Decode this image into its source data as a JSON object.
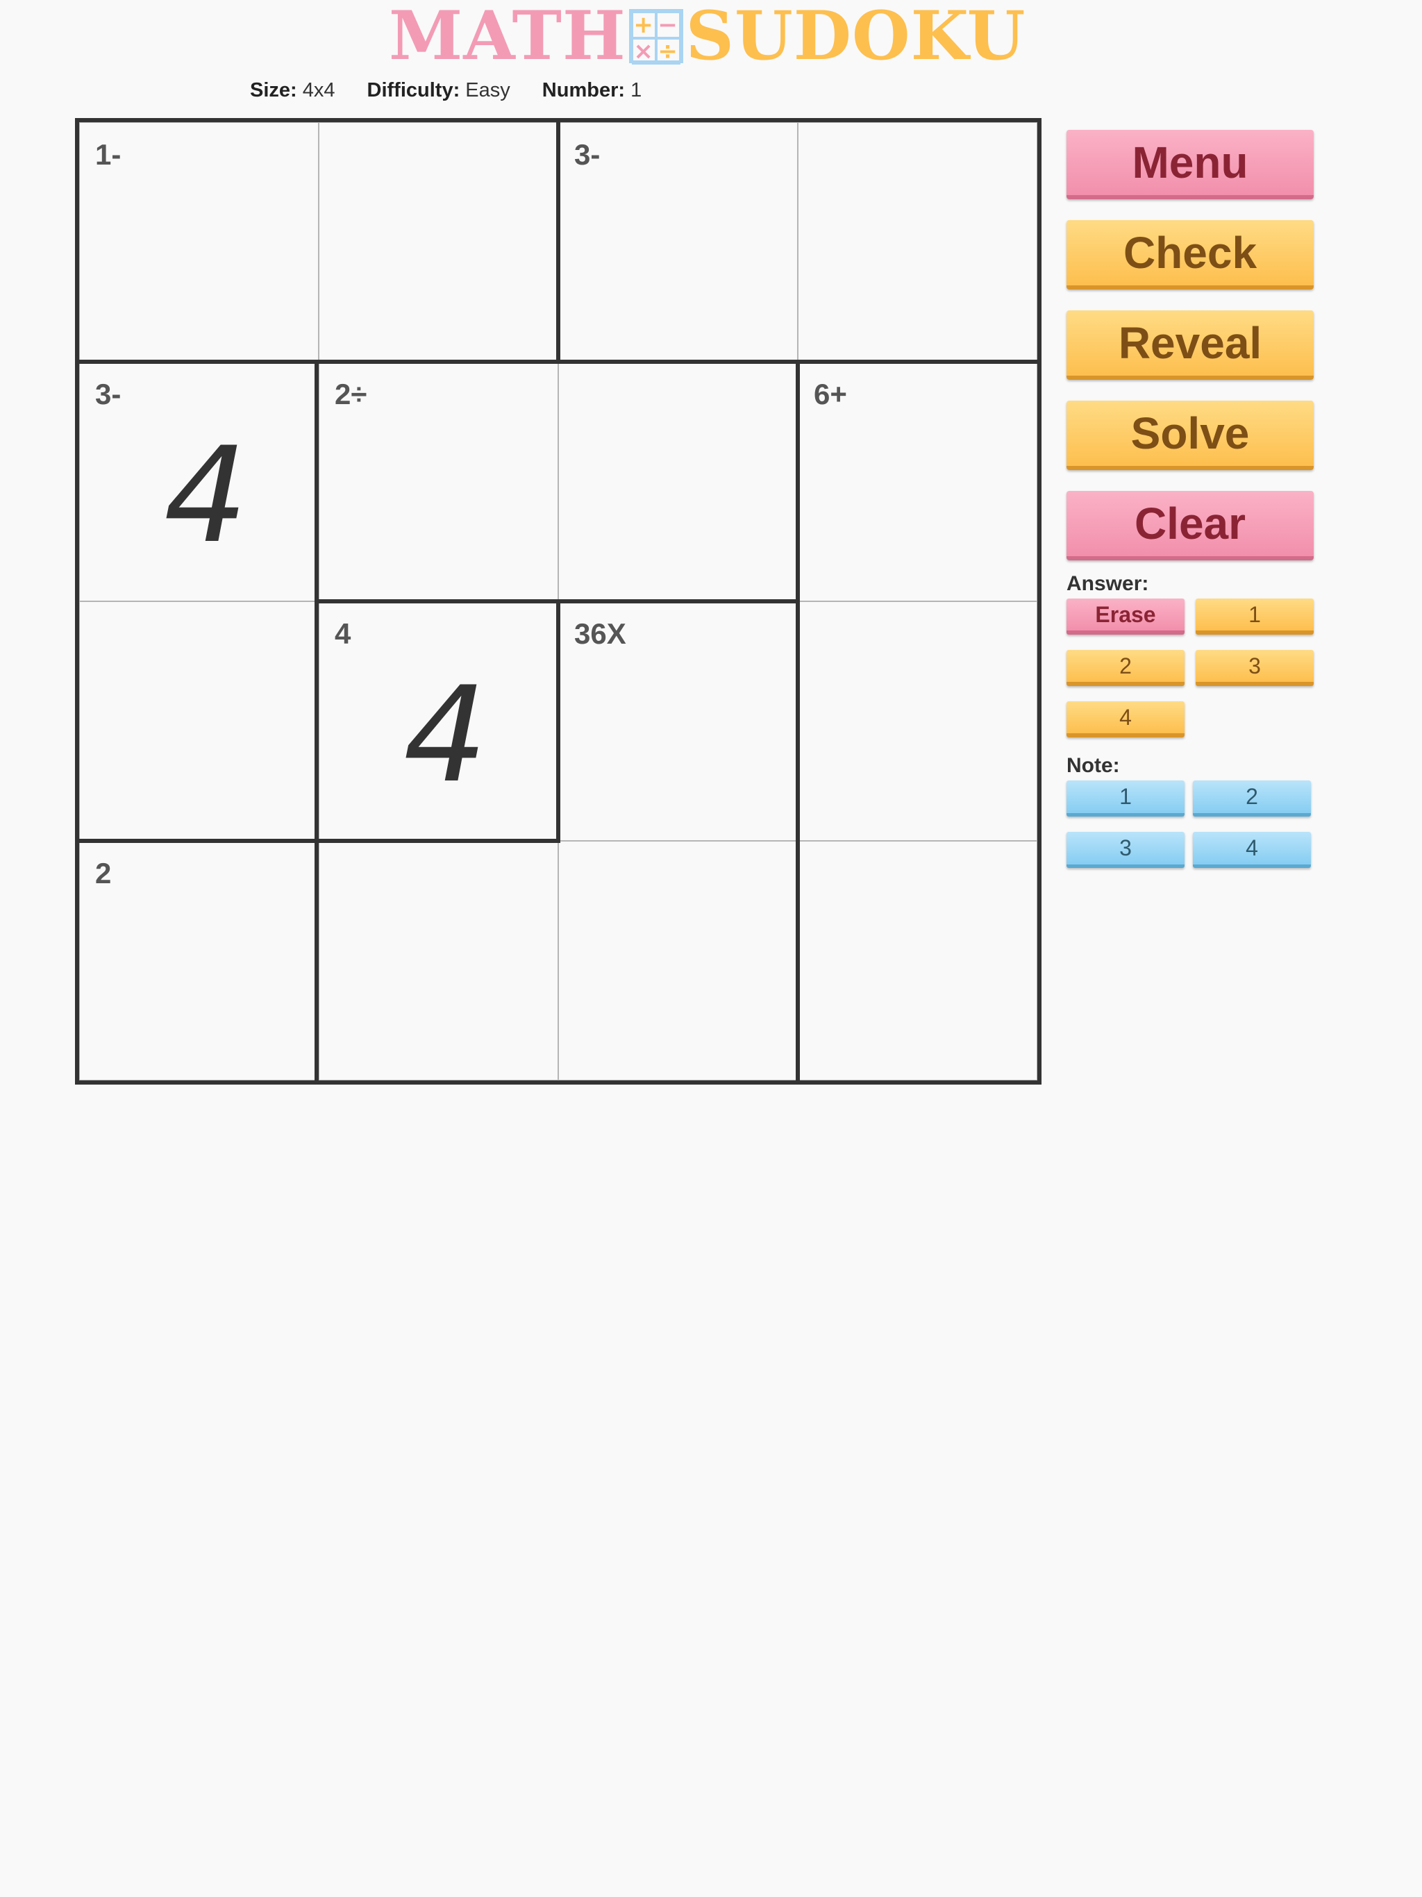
{
  "logo": {
    "left_text": "MATH",
    "right_text": "SUDOKU",
    "mark_symbols": [
      "+",
      "−",
      "×",
      "÷"
    ]
  },
  "info": {
    "size_label": "Size:",
    "size_value": "4x4",
    "difficulty_label": "Difficulty:",
    "difficulty_value": "Easy",
    "number_label": "Number:",
    "number_value": "1"
  },
  "board": {
    "size": 4,
    "clues": [
      [
        "1-",
        "",
        "3-",
        ""
      ],
      [
        "3-",
        "2÷",
        "",
        "6+"
      ],
      [
        "",
        "4",
        "36X",
        ""
      ],
      [
        "2",
        "",
        "",
        ""
      ]
    ],
    "values": [
      [
        "",
        "",
        "",
        ""
      ],
      [
        "4",
        "",
        "",
        ""
      ],
      [
        "",
        "4",
        "",
        ""
      ],
      [
        "",
        "",
        "",
        ""
      ]
    ]
  },
  "controls": {
    "menu": "Menu",
    "check": "Check",
    "reveal": "Reveal",
    "solve": "Solve",
    "clear": "Clear"
  },
  "answer": {
    "label": "Answer:",
    "erase": "Erase",
    "numbers": [
      "1",
      "2",
      "3",
      "4"
    ]
  },
  "note": {
    "label": "Note:",
    "numbers": [
      "1",
      "2",
      "3",
      "4"
    ]
  },
  "colors": {
    "pink": "#f39bb5",
    "yellow": "#fdbf4e",
    "blue": "#86cdf2",
    "grid": "#333333"
  }
}
